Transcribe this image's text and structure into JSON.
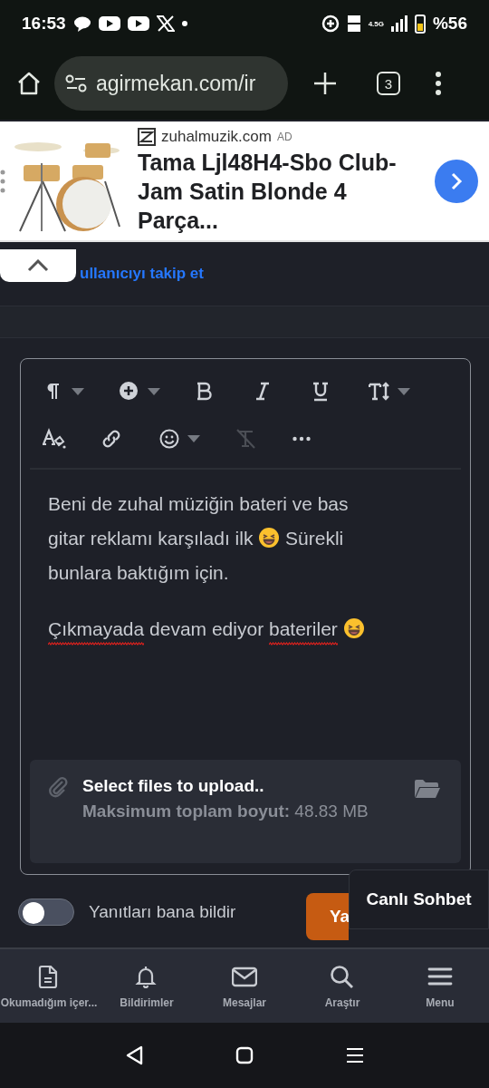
{
  "status_bar": {
    "time": "16:53",
    "battery": "%56",
    "network": "4.5G"
  },
  "browser": {
    "url": "agirmekan.com/ir",
    "tab_count": "3"
  },
  "ad": {
    "domain": "zuhalmuzik.com",
    "badge": "AD",
    "title": "Tama Ljl48H4-Sbo Club-Jam Satin Blonde 4 Parça..."
  },
  "follow_link": "ullanıcıyı takip et",
  "editor": {
    "toolbar": [
      {
        "kind": "paragraph",
        "dropdown": true,
        "disabled": false
      },
      {
        "kind": "insert",
        "dropdown": true,
        "disabled": false
      },
      {
        "kind": "bold",
        "dropdown": false,
        "disabled": false
      },
      {
        "kind": "italic",
        "dropdown": false,
        "disabled": false
      },
      {
        "kind": "underline",
        "dropdown": false,
        "disabled": false
      },
      {
        "kind": "size",
        "dropdown": true,
        "disabled": false
      },
      {
        "kind": "color",
        "dropdown": false,
        "disabled": false
      },
      {
        "kind": "link",
        "dropdown": false,
        "disabled": false
      },
      {
        "kind": "emoji",
        "dropdown": true,
        "disabled": false
      },
      {
        "kind": "clear",
        "dropdown": false,
        "disabled": true
      },
      {
        "kind": "more",
        "dropdown": false,
        "disabled": false
      }
    ],
    "paragraphs": [
      [
        {
          "kind": "text",
          "text": "Beni de zuhal müziğin bateri ve bas",
          "misspelled": false
        },
        {
          "kind": "text",
          "text": "gitar reklamı karşıladı ilk",
          "misspelled": false
        },
        {
          "kind": "emoji"
        },
        {
          "kind": "text",
          "text": "Sürekli",
          "misspelled": false
        },
        {
          "kind": "text",
          "text": "bunlara baktığım için.",
          "misspelled": false
        }
      ],
      [
        {
          "kind": "text",
          "text": "Çıkmayada",
          "misspelled": true
        },
        {
          "kind": "text",
          "text": "devam ediyor",
          "misspelled": false
        },
        {
          "kind": "text",
          "text": "bateriler",
          "misspelled": true
        },
        {
          "kind": "emoji"
        }
      ]
    ],
    "upload": {
      "title": "Select files to upload..",
      "limit_label": "Maksimum toplam boyut:",
      "limit_value": "48.83 MB"
    }
  },
  "notify_toggle": {
    "label": "Yanıtları bana bildir",
    "on": false
  },
  "submit_button": "Ya",
  "chat_popup": "Canlı Sohbet",
  "bottom_nav": [
    {
      "label": "Okumadığım içer..."
    },
    {
      "label": "Bildirimler"
    },
    {
      "label": "Mesajlar"
    },
    {
      "label": "Araştır"
    },
    {
      "label": "Menu"
    }
  ]
}
